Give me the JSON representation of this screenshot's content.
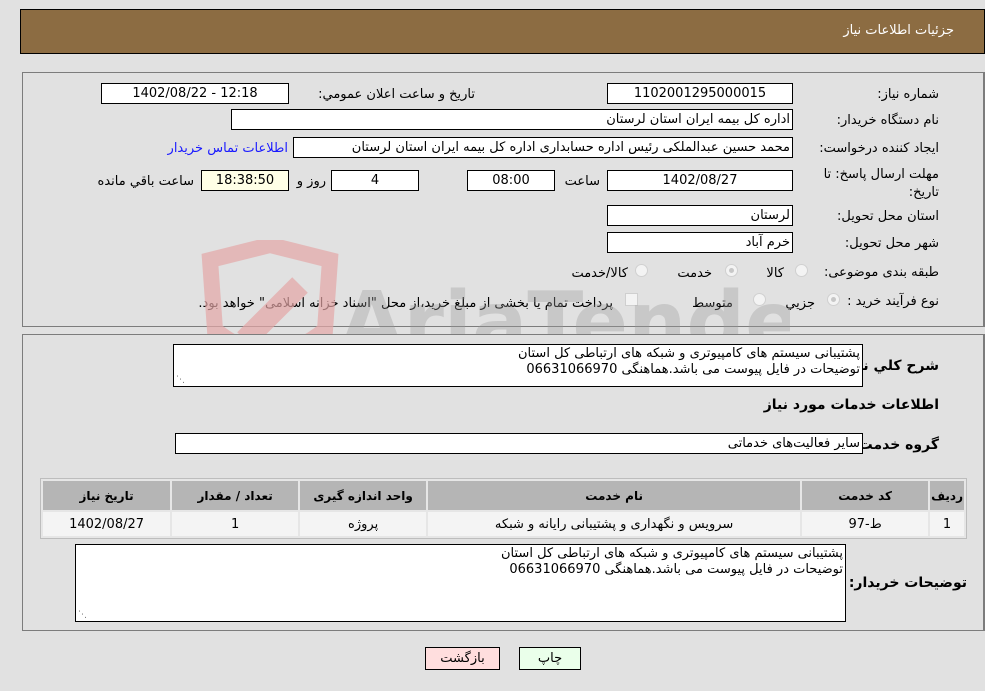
{
  "header": {
    "title": "جزئیات اطلاعات نیاز"
  },
  "fields": {
    "need_number": {
      "label": "شماره نیاز:",
      "value": "1102001295000015"
    },
    "announce_datetime": {
      "label": "تاریخ و ساعت اعلان عمومي:",
      "value": "1402/08/22 - 12:18"
    },
    "buyer_org": {
      "label": "نام دستگاه خريدار:",
      "value": "اداره کل بیمه ایران استان لرستان"
    },
    "requester": {
      "label": "ایجاد کننده درخواست:",
      "value": "محمد حسین  عبدالملکی  رئیس اداره حسابداری  اداره کل بیمه ایران استان لرستان",
      "contact_link": "اطلاعات تماس خریدار"
    },
    "deadline": {
      "label": "مهلت ارسال پاسخ: تا تاریخ:",
      "date": "1402/08/27",
      "time_label": "ساعت",
      "time": "08:00",
      "days": "4",
      "days_label": "روز و",
      "remaining": "18:38:50",
      "remaining_label": "ساعت باقي مانده"
    },
    "delivery_province": {
      "label": "استان محل تحویل:",
      "value": "لرستان"
    },
    "delivery_city": {
      "label": "شهر محل تحویل:",
      "value": "خرم آباد"
    },
    "category": {
      "label": "طبقه بندی موضوعی:",
      "options": [
        {
          "label": "کالا",
          "selected": false
        },
        {
          "label": "خدمت",
          "selected": true
        },
        {
          "label": "کالا/خدمت",
          "selected": false
        }
      ]
    },
    "purchase_type": {
      "label": "نوع فرآیند خرید :",
      "options": [
        {
          "label": "جزيي",
          "selected": true
        },
        {
          "label": "متوسط",
          "selected": false
        }
      ],
      "treasury_note": "پرداخت تمام یا بخشی از مبلغ خرید،از محل \"اسناد خزانه اسلامی\" خواهد بود.",
      "treasury_checked": false
    }
  },
  "description": {
    "label": "شرح كلي نياز:",
    "lines": [
      "پشتیبانی سیستم های کامپیوتری و شبکه های ارتباطی کل استان",
      "توضیحات در فایل پیوست می باشد.هماهنگی 06631066970"
    ]
  },
  "services": {
    "section_title": "اطلاعات خدمات مورد نیاز",
    "group_label": "گروه خدمت:",
    "group_value": "سایر فعالیت‌های خدماتی",
    "columns": [
      "رديف",
      "کد خدمت",
      "نام خدمت",
      "واحد اندازه گیری",
      "تعداد / مقدار",
      "تاریخ نیاز"
    ],
    "rows": [
      [
        "1",
        "ط-97",
        "سرویس و نگهداری و پشتیبانی رایانه و شبکه",
        "پروژه",
        "1",
        "1402/08/27"
      ]
    ]
  },
  "buyer_notes": {
    "label": "توضیحات خریدار:",
    "lines": [
      "پشتیبانی سیستم های کامپیوتری و شبکه های ارتباطی کل استان",
      "توضیحات در فایل پیوست می باشد.هماهنگی 06631066970"
    ]
  },
  "buttons": {
    "print": "چاپ",
    "back": "بازگشت"
  },
  "watermark": {
    "text": "AriaTender.neT"
  }
}
